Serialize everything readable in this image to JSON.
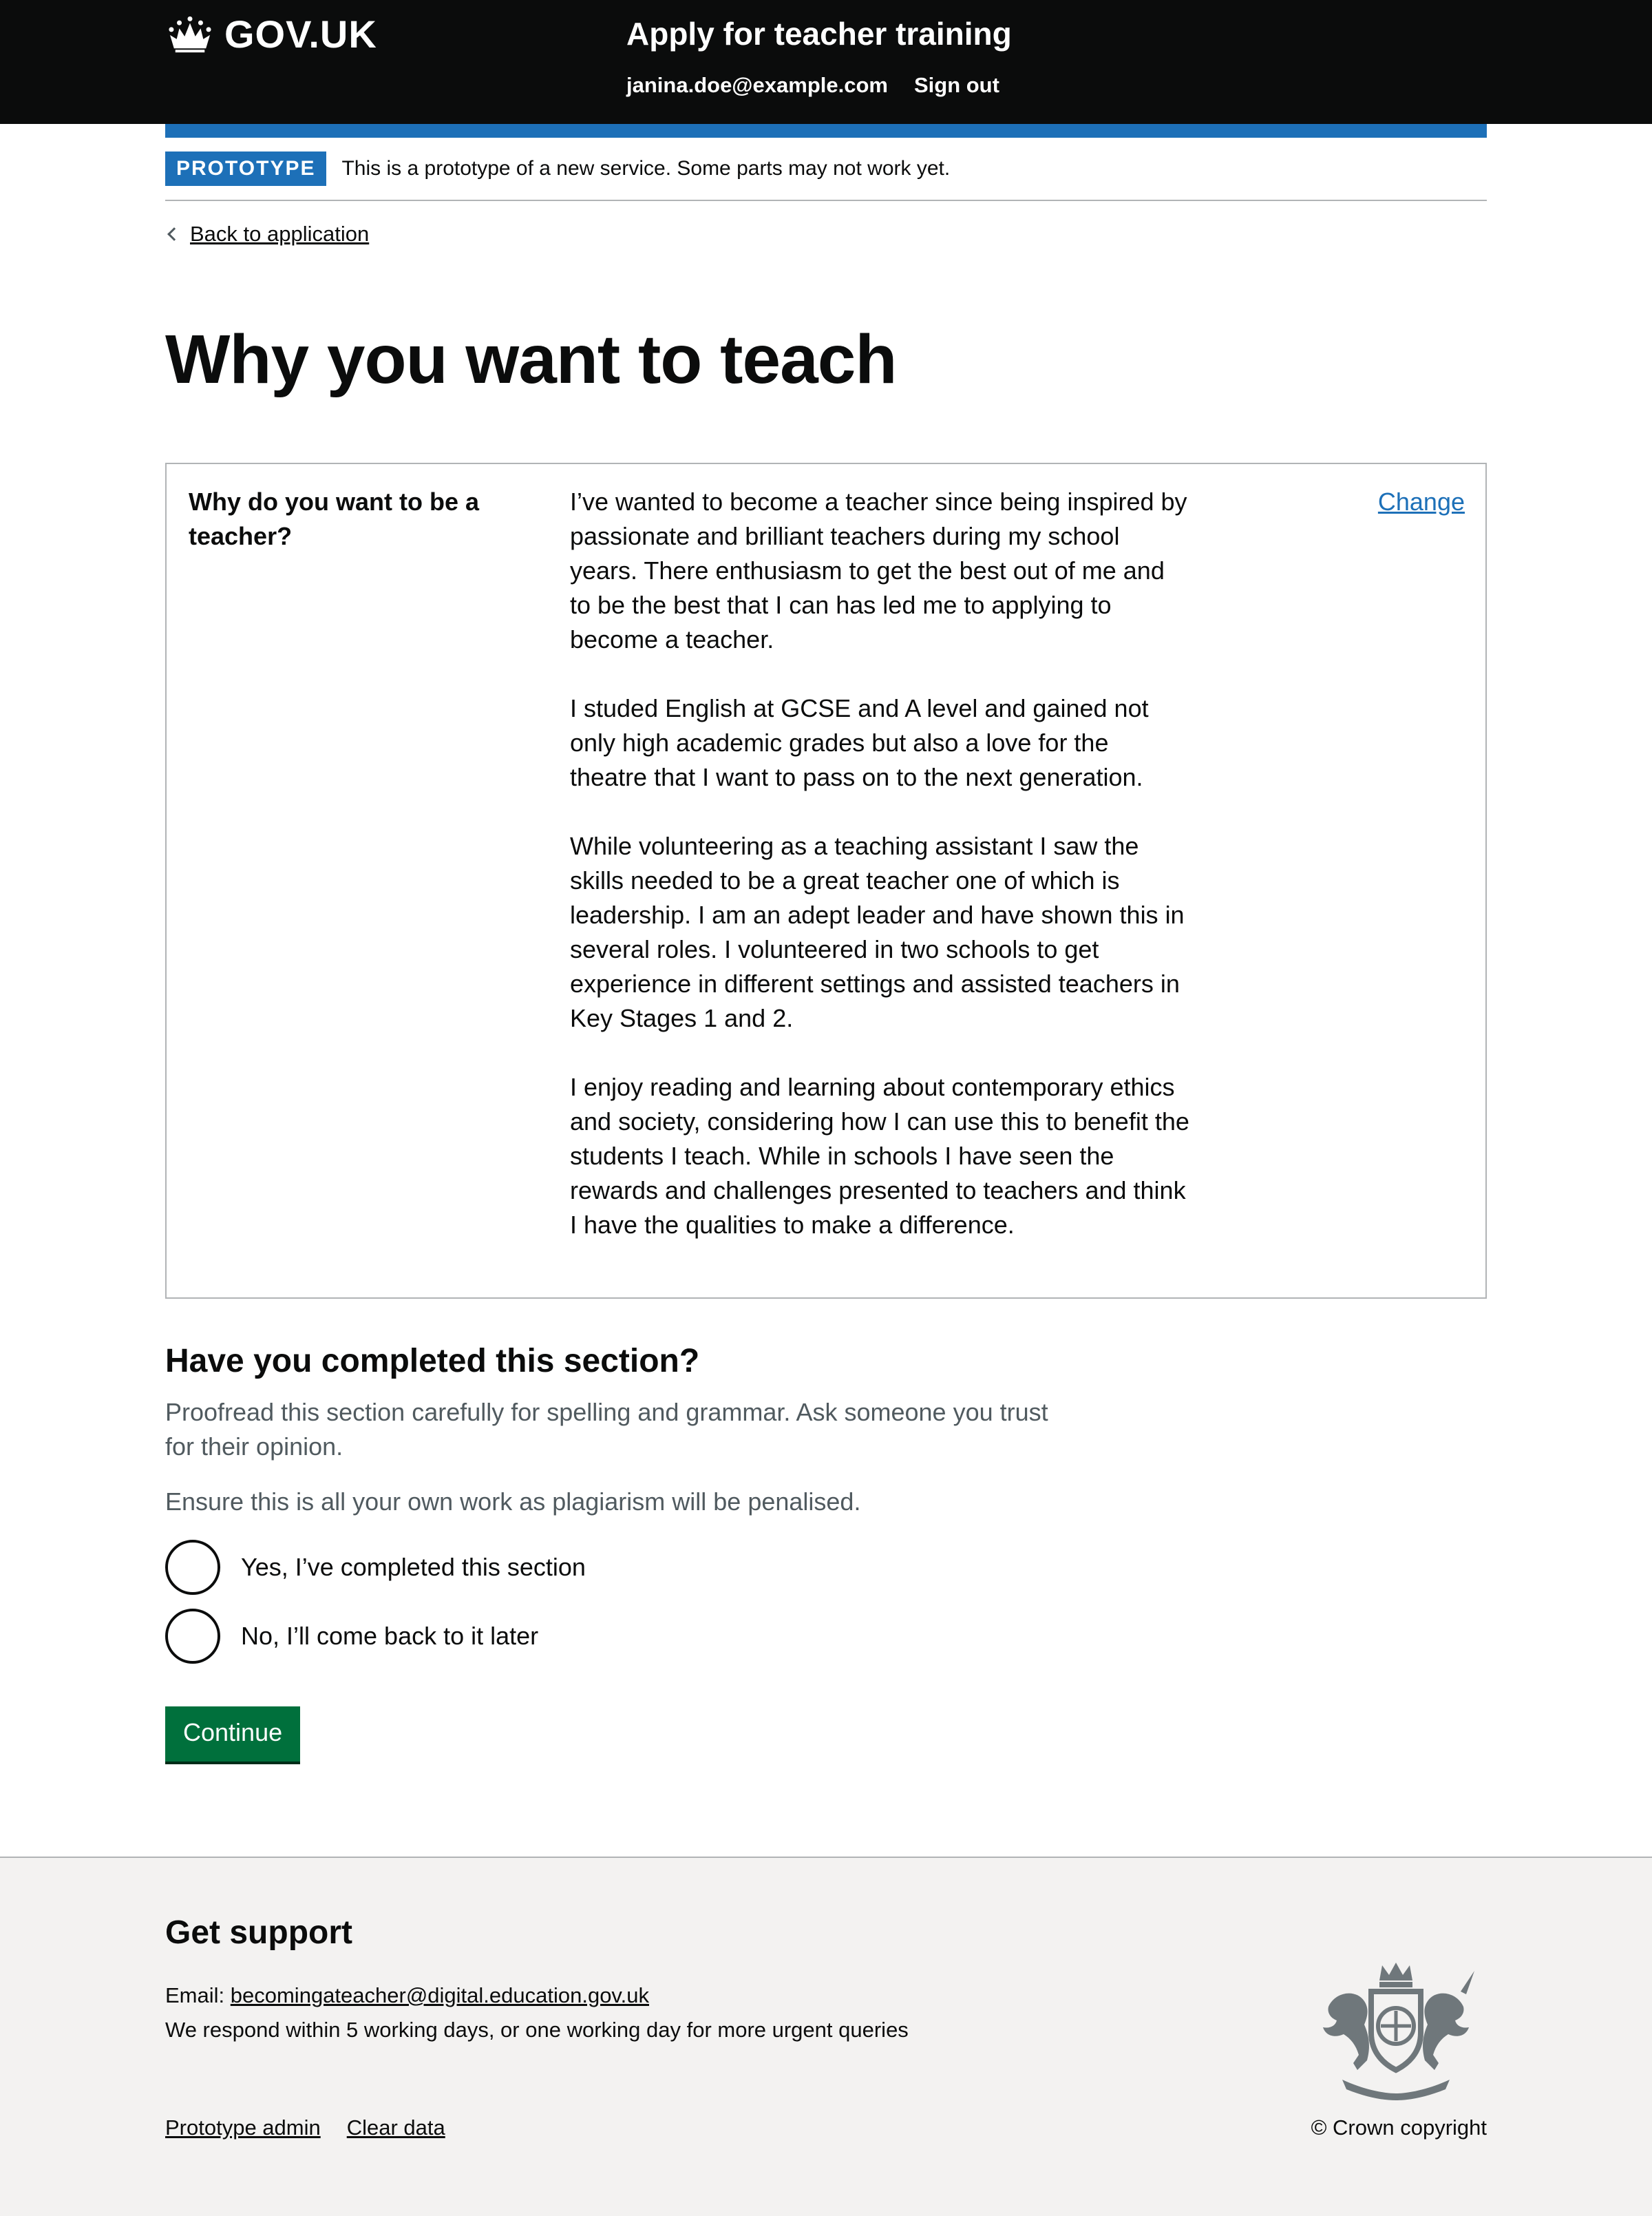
{
  "header": {
    "logo_text": "GOV.UK",
    "service_name": "Apply for teacher training",
    "nav": {
      "user_email": "janina.doe@example.com",
      "sign_out": "Sign out"
    }
  },
  "phase_banner": {
    "tag": "PROTOTYPE",
    "text": "This is a prototype of a new service. Some parts may not work yet."
  },
  "back_link": "Back to application",
  "page_title": "Why you want to teach",
  "summary": {
    "key": "Why do you want to be a teacher?",
    "change_label": "Change",
    "paragraphs": [
      "I’ve wanted to become a teacher since being inspired by passionate and brilliant teachers during my school years. There enthusiasm to get the best out of me and to be the best that I can has led me to applying to become a teacher.",
      "I studed English at GCSE and A level and gained not only high academic grades but also a love for the theatre that I want to pass on to the next generation.",
      "While volunteering as a teaching assistant I saw the skills needed to be a great teacher one of which is leadership. I am an adept leader and have shown this in several roles. I volunteered in two schools to get experience in different settings and assisted teachers in Key Stages 1 and 2.",
      "I enjoy reading and learning about contemporary ethics and society, considering how I can use this to benefit the students I teach. While in schools I have seen the rewards and challenges presented to teachers and think I have the qualities to make a difference."
    ]
  },
  "completed": {
    "heading": "Have you completed this section?",
    "hint_1": "Proofread this section carefully for spelling and grammar. Ask someone you trust for their opinion.",
    "hint_2": "Ensure this is all your own work as plagiarism will be penalised.",
    "options": [
      {
        "label": "Yes, I’ve completed this section",
        "selected": false
      },
      {
        "label": "No, I’ll come back to it later",
        "selected": false
      }
    ],
    "continue_label": "Continue"
  },
  "footer": {
    "title": "Get support",
    "email_prefix": "Email:",
    "email": "becomingateacher@digital.education.gov.uk",
    "response_text": "We respond within 5 working days, or one working day for more urgent queries",
    "links": [
      "Prototype admin",
      "Clear data"
    ],
    "copyright": "© Crown copyright"
  },
  "colors": {
    "header_bg": "#0b0c0c",
    "brand_blue": "#1d70b8",
    "button_green": "#00703c",
    "footer_bg": "#f3f2f1",
    "hint_grey": "#505a5f"
  }
}
